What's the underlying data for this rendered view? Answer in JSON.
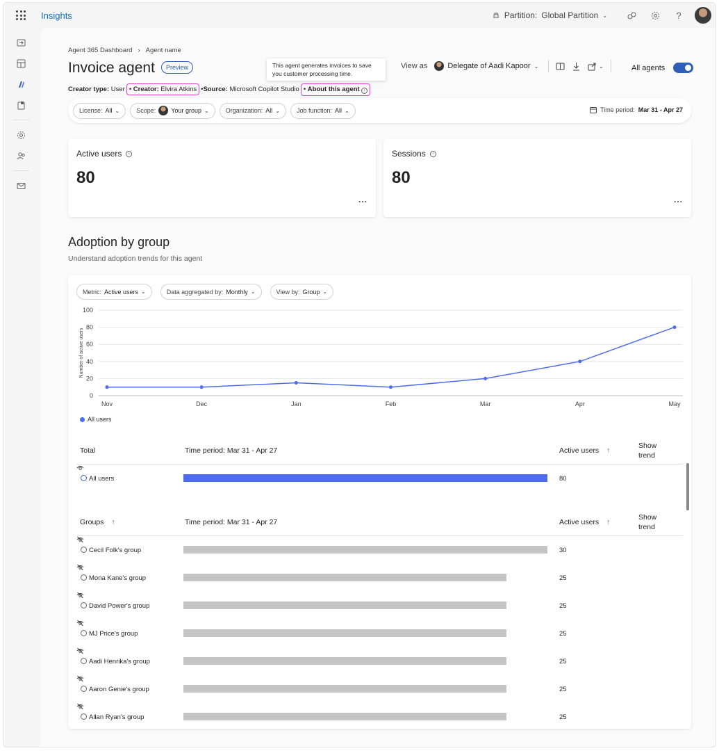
{
  "app": {
    "title": "Insights"
  },
  "topbar": {
    "partition_label": "Partition:",
    "partition_value": "Global Partition",
    "help": "?"
  },
  "breadcrumb": [
    "Agent 365 Dashboard",
    "Agent name"
  ],
  "page": {
    "title": "Invoice agent",
    "badge": "Preview",
    "creator_type_label": "Creator type:",
    "creator_type_value": "User",
    "creator_label": "Creator:",
    "creator_value": "Elvira Atkins",
    "source_label": "Source:",
    "source_value": "Microsoft Copilot Studio",
    "about_link": "About this agent",
    "tooltip": "This agent generates invoices to save you customer processing time."
  },
  "view_as": {
    "label": "View as",
    "person": "Delegate of Aadi Kapoor"
  },
  "all_agents": {
    "label": "All agents",
    "on": true
  },
  "filters": [
    {
      "key": "License:",
      "value": "All"
    },
    {
      "key": "Scope:",
      "value": "Your group"
    },
    {
      "key": "Organization:",
      "value": "All"
    },
    {
      "key": "Job function:",
      "value": "All"
    }
  ],
  "time_period": {
    "label": "Time period:",
    "value": "Mar 31 - Apr 27"
  },
  "cards": [
    {
      "title": "Active users",
      "value": "80",
      "more": "..."
    },
    {
      "title": "Sessions",
      "value": "80",
      "more": "..."
    }
  ],
  "adoption": {
    "title": "Adoption by group",
    "subtitle": "Understand adoption trends for this agent",
    "chart_filters": [
      {
        "key": "Metric:",
        "value": "Active users"
      },
      {
        "key": "Data aggregated by:",
        "value": "Monthly"
      },
      {
        "key": "View by:",
        "value": "Group"
      }
    ]
  },
  "chart_data": {
    "type": "line",
    "categories": [
      "Nov",
      "Dec",
      "Jan",
      "Feb",
      "Mar",
      "Apr",
      "May"
    ],
    "series": [
      {
        "name": "All users",
        "values": [
          10,
          10,
          15,
          10,
          20,
          40,
          80
        ]
      }
    ],
    "ylabel": "Number of active users",
    "yticks": [
      "0",
      "20",
      "40",
      "60",
      "80",
      "100"
    ],
    "ylim": [
      0,
      100
    ],
    "grid": true,
    "legend": "bottom-left",
    "color": "#4f6bed"
  },
  "total_table": {
    "col1": "Total",
    "col2": "Time period: Mar 31 - Apr 27",
    "col3": "Active users",
    "col4": "Show trend",
    "rows": [
      {
        "name": "All users",
        "value": "80",
        "fraction": 1.0
      }
    ]
  },
  "groups_table": {
    "col1": "Groups",
    "col2": "Time period: Mar 31 - Apr 27",
    "col3": "Active users",
    "col4": "Show trend",
    "rows": [
      {
        "name": "Cecil Folk's group",
        "value": "30",
        "fraction": 1.0
      },
      {
        "name": "Mona Kane's group",
        "value": "25",
        "fraction": 0.887
      },
      {
        "name": "David Power's group",
        "value": "25",
        "fraction": 0.887
      },
      {
        "name": "MJ Price's group",
        "value": "25",
        "fraction": 0.887
      },
      {
        "name": "Aadi Henrika's group",
        "value": "25",
        "fraction": 0.887
      },
      {
        "name": "Aaron Genie's group",
        "value": "25",
        "fraction": 0.887
      },
      {
        "name": "Allan Ryan's group",
        "value": "25",
        "fraction": 0.887
      }
    ]
  },
  "colors": {
    "accent": "#2f5fb8",
    "series": "#4f6bed",
    "highlight": "#e040c9",
    "bar_grey": "#c4c4c4"
  }
}
